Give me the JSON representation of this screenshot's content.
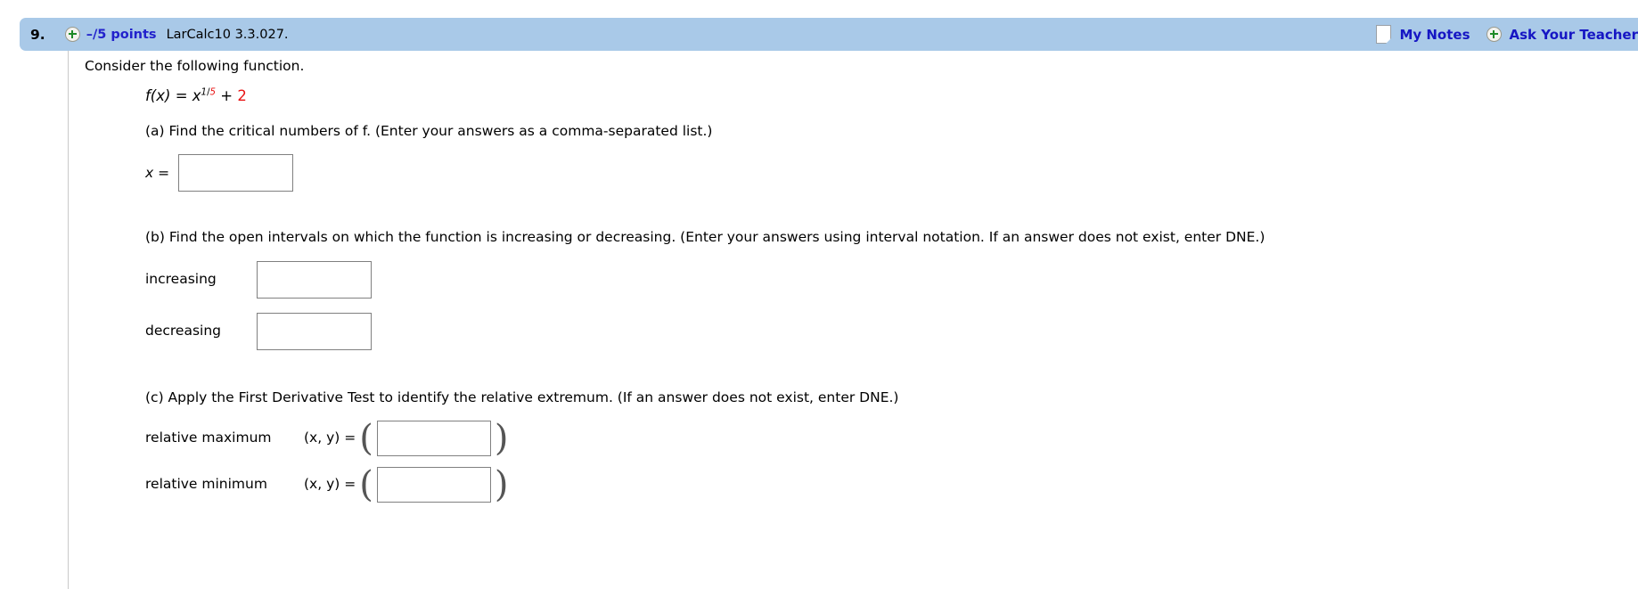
{
  "header": {
    "question_number": "9.",
    "expand_icon": "plus-circle-icon",
    "points": "–/5 points",
    "reference": "LarCalc10 3.3.027.",
    "notes_icon": "document-icon",
    "notes_label": "My Notes",
    "teacher_icon": "plus-circle-icon",
    "teacher_label": "Ask Your Teacher",
    "bar_color": "#a9c9e8",
    "link_color": "#1616c4"
  },
  "body": {
    "intro": "Consider the following function.",
    "formula": {
      "fx": "f(x)",
      "equals": "=",
      "base": "x",
      "exp_num": "1",
      "exp_slash": "/",
      "exp_den": "5",
      "plus": "+",
      "constant": "2",
      "highlight_color": "#e81313"
    },
    "parts": [
      {
        "id": "a",
        "prompt": "(a) Find the critical numbers of f. (Enter your answers as a comma-separated list.)",
        "fields": [
          {
            "label": "x =",
            "name": "critical-numbers-input",
            "value": "",
            "placeholder": ""
          }
        ]
      },
      {
        "id": "b",
        "prompt": "(b) Find the open intervals on which the function is increasing or decreasing. (Enter your answers using interval notation. If an answer does not exist, enter DNE.)",
        "fields": [
          {
            "label": "increasing",
            "name": "increasing-interval-input",
            "value": "",
            "placeholder": ""
          },
          {
            "label": "decreasing",
            "name": "decreasing-interval-input",
            "value": "",
            "placeholder": ""
          }
        ]
      },
      {
        "id": "c",
        "prompt": "(c) Apply the First Derivative Test to identify the relative extremum. (If an answer does not exist, enter DNE.)",
        "xy_label": "(x, y)  =",
        "open_paren": "(",
        "close_paren": ")",
        "fields": [
          {
            "label": "relative maximum",
            "name": "relative-maximum-input",
            "value": "",
            "placeholder": ""
          },
          {
            "label": "relative minimum",
            "name": "relative-minimum-input",
            "value": "",
            "placeholder": ""
          }
        ]
      }
    ]
  }
}
